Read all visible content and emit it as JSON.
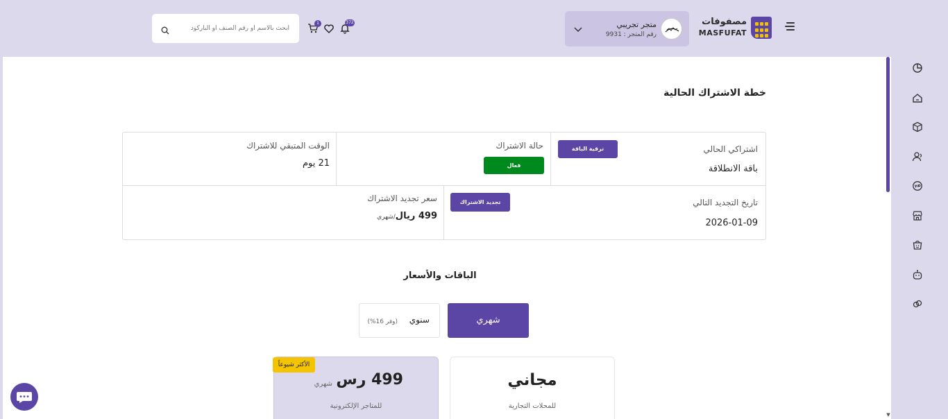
{
  "header": {
    "logo_ar": "مصفوفات",
    "logo_en": "MASFUFAT",
    "store_name": "متجر تجريبي",
    "store_number": "رقم المتجر : 9931",
    "notifications_count": "372",
    "cart_count": "1",
    "search_placeholder": "ابحث بالاسم أو رقم الصنف أو الباركود"
  },
  "page": {
    "title": "خطة الاشتراك الحالية"
  },
  "subscription": {
    "current_label": "اشتراكي الحالي",
    "current_value": "باقة الانطلاقة",
    "upgrade_button": "ترقية الباقة",
    "status_label": "حالة الاشتراك",
    "status_value": "فعال",
    "remaining_label": "الوقت المتبقي للاشتراك",
    "remaining_value": "21 يوم",
    "renewal_date_label": "تاريخ التجديد التالي",
    "renewal_date_value": "2026-01-09",
    "renew_button": "تجديد الاشتراك",
    "renewal_price_label": "سعر تجديد الاشتراك",
    "renewal_price_value": "499 ريال",
    "renewal_price_period": "/شهري"
  },
  "plans": {
    "title": "الباقات والأسعار",
    "toggle_monthly": "شهري",
    "toggle_yearly": "سنوي",
    "toggle_yearly_save": "(وفر 16%)",
    "popular_badge": "الأكثر شيوعاً",
    "cards": [
      {
        "price": "مجاني",
        "period": "",
        "description": "للمحلات التجارية"
      },
      {
        "price": "499 رس",
        "period": "شهري",
        "description": "للمتاجر الإلكترونية"
      }
    ]
  },
  "colors": {
    "accent": "#5b46a5",
    "background": "#ddd9ed",
    "active_status": "#008a1e",
    "badge_yellow": "#f5c400"
  },
  "sidebar_icons": [
    "dashboard-icon",
    "home-icon",
    "box-icon",
    "users-icon",
    "vip-icon",
    "store-icon",
    "smile-bag-icon",
    "robot-icon",
    "link-icon"
  ]
}
